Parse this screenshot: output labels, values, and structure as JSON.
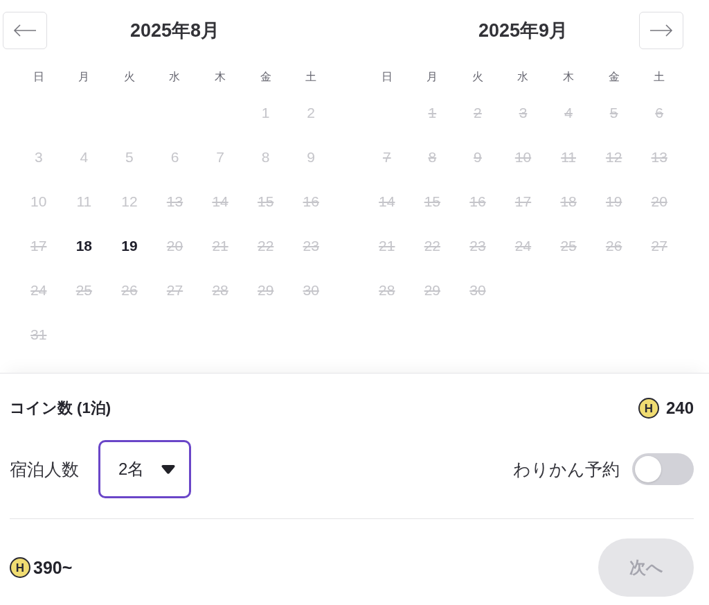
{
  "months": [
    {
      "title": "2025年8月",
      "nav_button": {
        "kind": "prev"
      },
      "weekdays": [
        "日",
        "月",
        "火",
        "水",
        "木",
        "金",
        "土"
      ],
      "weeks": [
        [
          {
            "kind": "empty"
          },
          {
            "kind": "empty"
          },
          {
            "kind": "empty"
          },
          {
            "kind": "empty"
          },
          {
            "kind": "empty"
          },
          {
            "day": "1",
            "kind": "past"
          },
          {
            "day": "2",
            "kind": "past"
          }
        ],
        [
          {
            "day": "3",
            "kind": "past"
          },
          {
            "day": "4",
            "kind": "past"
          },
          {
            "day": "5",
            "kind": "past"
          },
          {
            "day": "6",
            "kind": "past"
          },
          {
            "day": "7",
            "kind": "past"
          },
          {
            "day": "8",
            "kind": "past"
          },
          {
            "day": "9",
            "kind": "past"
          }
        ],
        [
          {
            "day": "10",
            "kind": "past"
          },
          {
            "day": "11",
            "kind": "past"
          },
          {
            "day": "12",
            "kind": "past"
          },
          {
            "day": "13",
            "kind": "unavailable"
          },
          {
            "day": "14",
            "kind": "unavailable"
          },
          {
            "day": "15",
            "kind": "unavailable"
          },
          {
            "day": "16",
            "kind": "unavailable"
          }
        ],
        [
          {
            "day": "17",
            "kind": "unavailable"
          },
          {
            "day": "18",
            "kind": "available"
          },
          {
            "day": "19",
            "kind": "available"
          },
          {
            "day": "20",
            "kind": "unavailable"
          },
          {
            "day": "21",
            "kind": "unavailable"
          },
          {
            "day": "22",
            "kind": "unavailable"
          },
          {
            "day": "23",
            "kind": "unavailable"
          }
        ],
        [
          {
            "day": "24",
            "kind": "unavailable"
          },
          {
            "day": "25",
            "kind": "unavailable"
          },
          {
            "day": "26",
            "kind": "unavailable"
          },
          {
            "day": "27",
            "kind": "unavailable"
          },
          {
            "day": "28",
            "kind": "unavailable"
          },
          {
            "day": "29",
            "kind": "unavailable"
          },
          {
            "day": "30",
            "kind": "unavailable"
          }
        ],
        [
          {
            "day": "31",
            "kind": "unavailable"
          }
        ]
      ]
    },
    {
      "title": "2025年9月",
      "nav_button": {
        "kind": "next"
      },
      "weekdays": [
        "日",
        "月",
        "火",
        "水",
        "木",
        "金",
        "土"
      ],
      "weeks": [
        [
          {
            "kind": "empty"
          },
          {
            "day": "1",
            "kind": "unavailable"
          },
          {
            "day": "2",
            "kind": "unavailable"
          },
          {
            "day": "3",
            "kind": "unavailable"
          },
          {
            "day": "4",
            "kind": "unavailable"
          },
          {
            "day": "5",
            "kind": "unavailable"
          },
          {
            "day": "6",
            "kind": "unavailable"
          }
        ],
        [
          {
            "day": "7",
            "kind": "unavailable"
          },
          {
            "day": "8",
            "kind": "unavailable"
          },
          {
            "day": "9",
            "kind": "unavailable"
          },
          {
            "day": "10",
            "kind": "unavailable"
          },
          {
            "day": "11",
            "kind": "unavailable"
          },
          {
            "day": "12",
            "kind": "unavailable"
          },
          {
            "day": "13",
            "kind": "unavailable"
          }
        ],
        [
          {
            "day": "14",
            "kind": "unavailable"
          },
          {
            "day": "15",
            "kind": "unavailable"
          },
          {
            "day": "16",
            "kind": "unavailable"
          },
          {
            "day": "17",
            "kind": "unavailable"
          },
          {
            "day": "18",
            "kind": "unavailable"
          },
          {
            "day": "19",
            "kind": "unavailable"
          },
          {
            "day": "20",
            "kind": "unavailable"
          }
        ],
        [
          {
            "day": "21",
            "kind": "unavailable"
          },
          {
            "day": "22",
            "kind": "unavailable"
          },
          {
            "day": "23",
            "kind": "unavailable"
          },
          {
            "day": "24",
            "kind": "unavailable"
          },
          {
            "day": "25",
            "kind": "unavailable"
          },
          {
            "day": "26",
            "kind": "unavailable"
          },
          {
            "day": "27",
            "kind": "unavailable"
          }
        ],
        [
          {
            "day": "28",
            "kind": "unavailable"
          },
          {
            "day": "29",
            "kind": "unavailable"
          },
          {
            "day": "30",
            "kind": "unavailable"
          }
        ]
      ]
    }
  ],
  "coin_rate": {
    "label": "コイン数 (1泊)",
    "symbol": "H",
    "amount": "240"
  },
  "guests": {
    "label": "宿泊人数",
    "value": "2名"
  },
  "split_booking": {
    "label": "わりかん予約",
    "on": false
  },
  "total": {
    "symbol": "H",
    "amount": "390~"
  },
  "next_button": {
    "label": "次へ",
    "disabled": true
  }
}
